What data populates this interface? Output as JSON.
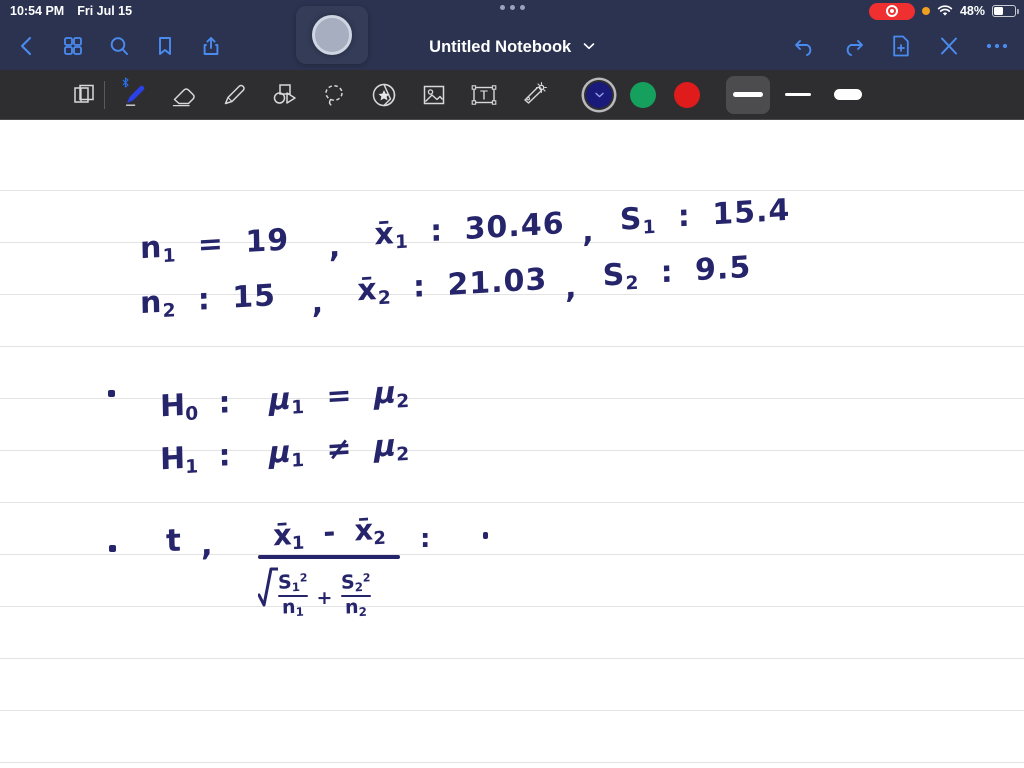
{
  "status_bar": {
    "time": "10:54 PM",
    "date": "Fri Jul 15",
    "battery_percent": "48%",
    "icons": [
      "screen-recording-pill",
      "orange-privacy-dot",
      "wifi-icon",
      "battery-icon"
    ]
  },
  "nav": {
    "title": "Untitled Notebook",
    "title_chevron": "⌄",
    "left_icons": [
      {
        "name": "back-button",
        "glyph": "chevron-left"
      },
      {
        "name": "page-grid-button",
        "glyph": "grid"
      },
      {
        "name": "search-button",
        "glyph": "magnifier"
      },
      {
        "name": "bookmark-button",
        "glyph": "bookmark"
      },
      {
        "name": "share-button",
        "glyph": "share-up-arrow"
      }
    ],
    "right_icons": [
      {
        "name": "undo-button",
        "glyph": "undo-arrow"
      },
      {
        "name": "redo-button",
        "glyph": "redo-arrow"
      },
      {
        "name": "new-page-button",
        "glyph": "document-plus"
      },
      {
        "name": "close-button",
        "glyph": "x-mark"
      },
      {
        "name": "more-options-button",
        "glyph": "ellipsis"
      }
    ]
  },
  "floating_bubble": {
    "name": "screen-record-bubble"
  },
  "toolbar": {
    "tools": [
      {
        "name": "page-layers-tool",
        "label": "Page"
      },
      {
        "name": "pen-tool",
        "label": "Pen",
        "active": true,
        "bluetooth": true
      },
      {
        "name": "eraser-tool",
        "label": "Eraser"
      },
      {
        "name": "highlighter-tool",
        "label": "Highlighter"
      },
      {
        "name": "shapes-tool",
        "label": "Shapes"
      },
      {
        "name": "lasso-tool",
        "label": "Lasso"
      },
      {
        "name": "sticker-tool",
        "label": "Sticker"
      },
      {
        "name": "image-tool",
        "label": "Image"
      },
      {
        "name": "text-box-tool",
        "label": "Text Box"
      },
      {
        "name": "magic-wand-tool",
        "label": "Laser"
      }
    ],
    "colors": [
      {
        "name": "color-swatch-navy",
        "hex": "#1a1a7a",
        "selected": true
      },
      {
        "name": "color-swatch-green",
        "hex": "#15a05e",
        "selected": false
      },
      {
        "name": "color-swatch-red",
        "hex": "#e01b1b",
        "selected": false
      }
    ],
    "widths": [
      {
        "name": "stroke-width-medium",
        "selected": true
      },
      {
        "name": "stroke-width-thin",
        "selected": false
      },
      {
        "name": "stroke-width-thick",
        "selected": false
      }
    ]
  },
  "canvas": {
    "ink_color": "#26256b",
    "rule_color": "#e3e3e5",
    "notes": {
      "line1": {
        "n_label": "n",
        "n_sub": "1",
        "n_eq": "=",
        "n_val": "19",
        "comma1": ",",
        "x_label": "x̄",
        "x_sub": "1",
        "x_eq": ":",
        "x_val": "30.46",
        "comma2": ",",
        "s_label": "S",
        "s_sub": "1",
        "s_eq": ":",
        "s_val": "15.4"
      },
      "line2": {
        "n_label": "n",
        "n_sub": "2",
        "n_eq": ":",
        "n_val": "15",
        "comma1": ",",
        "x_label": "x̄",
        "x_sub": "2",
        "x_eq": ":",
        "x_val": "21.03",
        "comma2": ",",
        "s_label": "S",
        "s_sub": "2",
        "s_eq": ":",
        "s_val": "9.5"
      },
      "hypothesis_null": {
        "name": "H",
        "sub": "0",
        "colon": ":",
        "lhs": "μ",
        "lhs_sub": "1",
        "relation": "=",
        "rhs": "μ",
        "rhs_sub": "2"
      },
      "hypothesis_alt": {
        "name": "H",
        "sub": "1",
        "colon": ":",
        "lhs": "μ",
        "lhs_sub": "1",
        "relation": "≠",
        "rhs": "μ",
        "rhs_sub": "2"
      },
      "t_statistic": {
        "symbol": "t",
        "colon": ",",
        "numerator_left": "x̄",
        "numerator_left_sub": "1",
        "numerator_minus": "-",
        "numerator_right": "x̄",
        "numerator_right_sub": "2",
        "den_s1": "S",
        "den_s1_sub": "1",
        "den_s1_sup": "2",
        "den_n1": "n",
        "den_n1_sub": "1",
        "den_plus": "+",
        "den_s2": "S",
        "den_s2_sub": "2",
        "den_s2_sup": "2",
        "den_n2": "n",
        "den_n2_sub": "2",
        "trailing_equals": ":"
      }
    }
  }
}
